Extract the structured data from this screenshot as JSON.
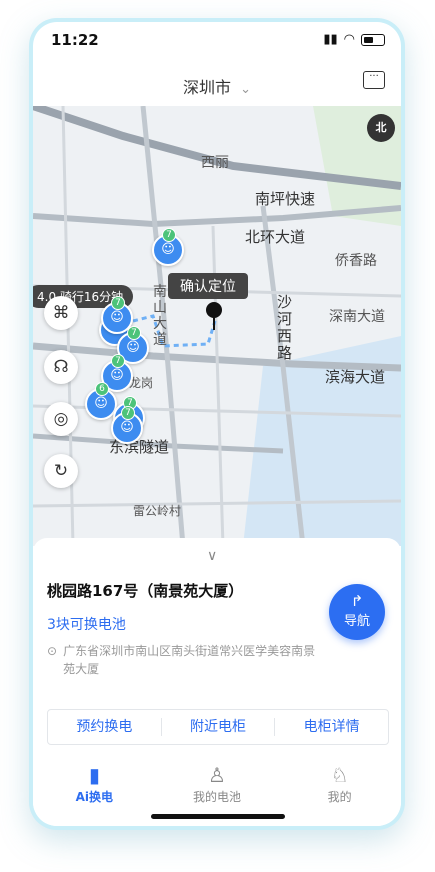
{
  "status": {
    "time": "11:22"
  },
  "header": {
    "city": "深圳市",
    "city_chevron": "⌄"
  },
  "map": {
    "labels": [
      "西丽",
      "南坪快速",
      "北环大道",
      "侨香路",
      "南山大道",
      "沙河西路",
      "深南大道",
      "滨海大道",
      "东滨隧道",
      "雷公岭村",
      "龙岗"
    ],
    "compass_label": "北",
    "confirm_label": "确认定位",
    "route_tip": "4.0 骑行16分钟",
    "stations": [
      "7",
      "7",
      "7",
      "7",
      "7",
      "6",
      "7",
      "7"
    ]
  },
  "station": {
    "name": "桃园路167号（南景苑大厦）",
    "battery_available": "3块可换电池",
    "address": "广东省深圳市南山区南头街道常兴医学美容南景苑大厦",
    "nav_label": "导航"
  },
  "actions": [
    "预约换电",
    "附近电柜",
    "电柜详情"
  ],
  "tabs": [
    {
      "label": "Ai换电",
      "icon": "battery-icon"
    },
    {
      "label": "我的电池",
      "icon": "battery-person-icon"
    },
    {
      "label": "我的",
      "icon": "person-icon"
    }
  ],
  "colors": {
    "accent": "#2d6df0",
    "station": "#3d8cf0",
    "badge": "#4cc37a"
  }
}
